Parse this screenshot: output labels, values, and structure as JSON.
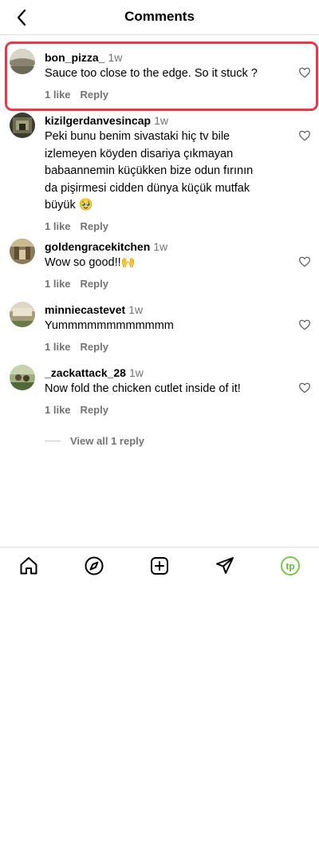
{
  "header": {
    "back_icon": "chevron-left-icon",
    "title": "Comments"
  },
  "colors": {
    "highlight_border": "#e23b4a",
    "secondary_text": "#737373",
    "divider": "#dbdbdb",
    "profile_accent": "#7ac943"
  },
  "comments": [
    {
      "username": "bon_pizza_",
      "time": "1w",
      "text": "Sauce too close to the edge. So it stuck ?",
      "likes": "1 like",
      "reply_label": "Reply",
      "highlighted": true
    },
    {
      "username": "kizilgerdanvesincap",
      "time": "1w",
      "text": "Peki bunu benim sivastaki hiç tv bile\nizlemeyen köyden disariya çıkmayan\nbabaannemin küçükken bize odun fırının\nda pişirmesi cidden dünya küçük mutfak\nbüyük 🥹",
      "likes": "1 like",
      "reply_label": "Reply"
    },
    {
      "username": "goldengracekitchen",
      "time": "1w",
      "text": "Wow so good!!🙌",
      "likes": "1 like",
      "reply_label": "Reply"
    },
    {
      "username": "minniecastevet",
      "time": "1w",
      "text": "Yummmmmmmmmmmm",
      "likes": "1 like",
      "reply_label": "Reply"
    },
    {
      "username": "_zackattack_28",
      "time": "1w",
      "text": "Now fold the chicken cutlet inside of it!",
      "likes": "1 like",
      "reply_label": "Reply"
    }
  ],
  "view_replies": "View all 1 reply",
  "bottom_nav": {
    "items": [
      "home-icon",
      "explore-compass-icon",
      "create-plus-icon",
      "direct-send-icon",
      "profile-tp-icon"
    ],
    "profile_initials": "tp"
  }
}
